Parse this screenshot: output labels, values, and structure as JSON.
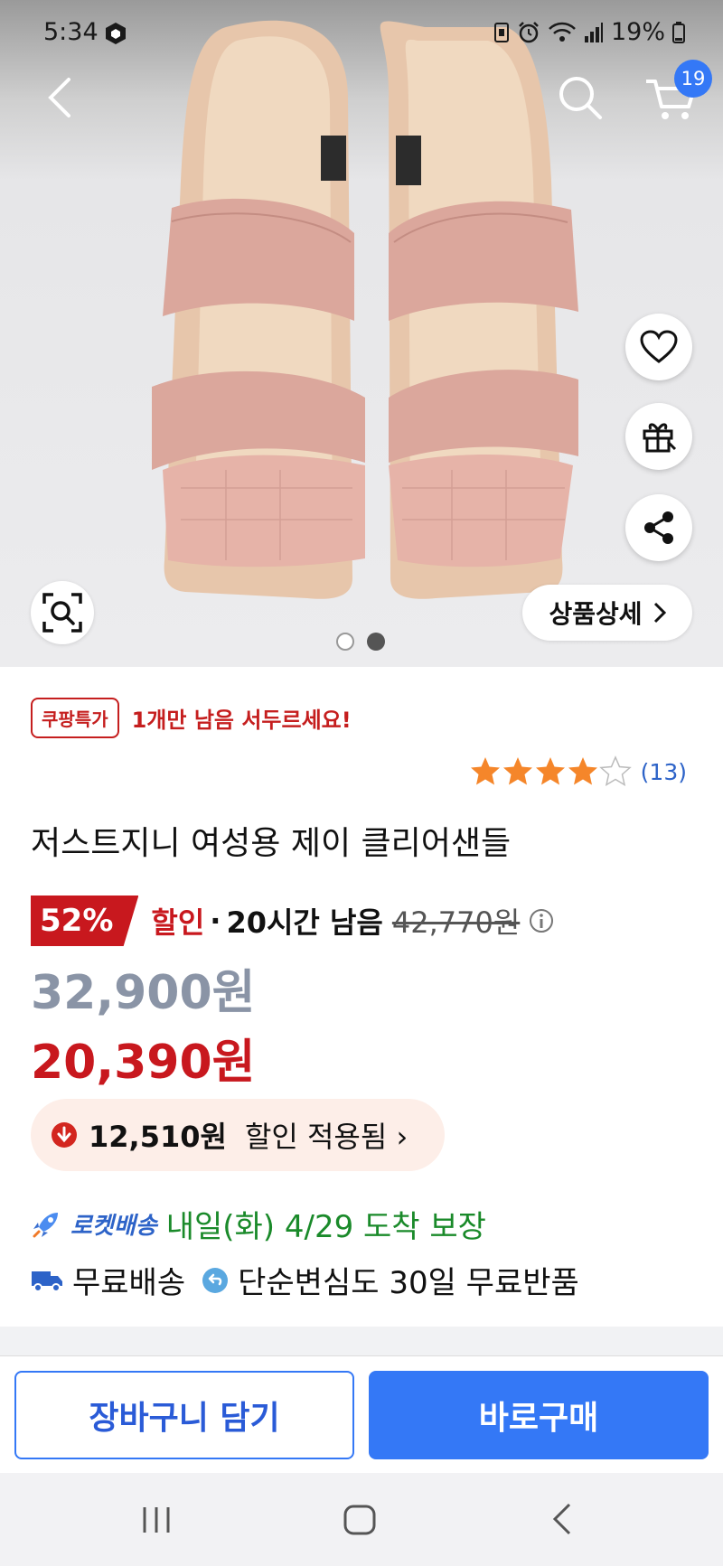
{
  "status_bar": {
    "time": "5:34",
    "battery": "19%"
  },
  "header": {
    "cart_count": "19"
  },
  "gallery": {
    "detail_button": "상품상세",
    "page_count": 2,
    "current_page": 2
  },
  "product": {
    "badge": "쿠팡특가",
    "urgency": "1개만 남음 서두르세요!",
    "rating": 4,
    "rating_max": 5,
    "review_count": "(13)",
    "title": "저스트지니 여성용 제이 클리어샌들",
    "discount_percent": "52%",
    "discount_label": "할인",
    "separator": "·",
    "time_remaining": "20시간 남음",
    "original_price": "42,770원",
    "list_price": "32,900원",
    "sale_price": "20,390원",
    "saving_amount": "12,510원",
    "saving_text": "할인 적용됨 ›",
    "rocket_label": "로켓배송",
    "delivery_promise": "내일(화) 4/29 도착 보장",
    "free_shipping": "무료배송",
    "return_policy": "단순변심도 30일 무료반품"
  },
  "actions": {
    "add_to_cart": "장바구니 담기",
    "buy_now": "바로구매"
  },
  "colors": {
    "accent_blue": "#3478f6",
    "sale_red": "#c8181e",
    "delivery_green": "#1a8a2a"
  }
}
